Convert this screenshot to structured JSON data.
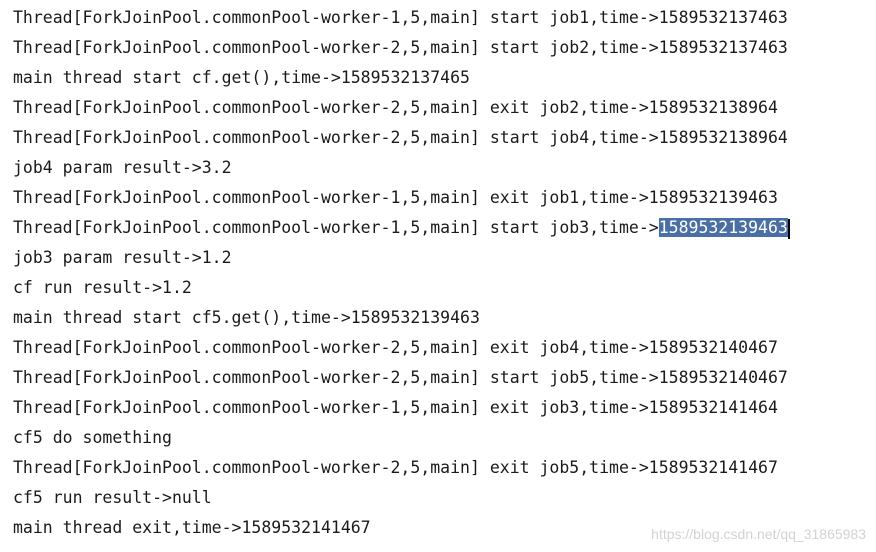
{
  "console": {
    "lines": [
      {
        "text": "Thread[ForkJoinPool.commonPool-worker-1,5,main] start job1,time->1589532137463"
      },
      {
        "text": "Thread[ForkJoinPool.commonPool-worker-2,5,main] start job2,time->1589532137463"
      },
      {
        "text": "main thread start cf.get(),time->1589532137465"
      },
      {
        "text": "Thread[ForkJoinPool.commonPool-worker-2,5,main] exit job2,time->1589532138964"
      },
      {
        "text": "Thread[ForkJoinPool.commonPool-worker-2,5,main] start job4,time->1589532138964"
      },
      {
        "text": "job4 param result->3.2"
      },
      {
        "text": "Thread[ForkJoinPool.commonPool-worker-1,5,main] exit job1,time->1589532139463"
      },
      {
        "text": "Thread[ForkJoinPool.commonPool-worker-1,5,main] start job3,time->",
        "selected": "1589532139463"
      },
      {
        "text": "job3 param result->1.2"
      },
      {
        "text": "cf run result->1.2"
      },
      {
        "text": "main thread start cf5.get(),time->1589532139463"
      },
      {
        "text": "Thread[ForkJoinPool.commonPool-worker-2,5,main] exit job4,time->1589532140467"
      },
      {
        "text": "Thread[ForkJoinPool.commonPool-worker-2,5,main] start job5,time->1589532140467"
      },
      {
        "text": "Thread[ForkJoinPool.commonPool-worker-1,5,main] exit job3,time->1589532141464"
      },
      {
        "text": "cf5 do something"
      },
      {
        "text": "Thread[ForkJoinPool.commonPool-worker-2,5,main] exit job5,time->1589532141467"
      },
      {
        "text": "cf5 run result->null"
      },
      {
        "text": "main thread exit,time->1589532141467"
      }
    ]
  },
  "watermark": "https://blog.csdn.net/qq_31865983",
  "colors": {
    "background": "#ffffff",
    "text": "#1a1a1a",
    "selection": "#4a6fa5",
    "watermark": "#d2d2d2"
  }
}
